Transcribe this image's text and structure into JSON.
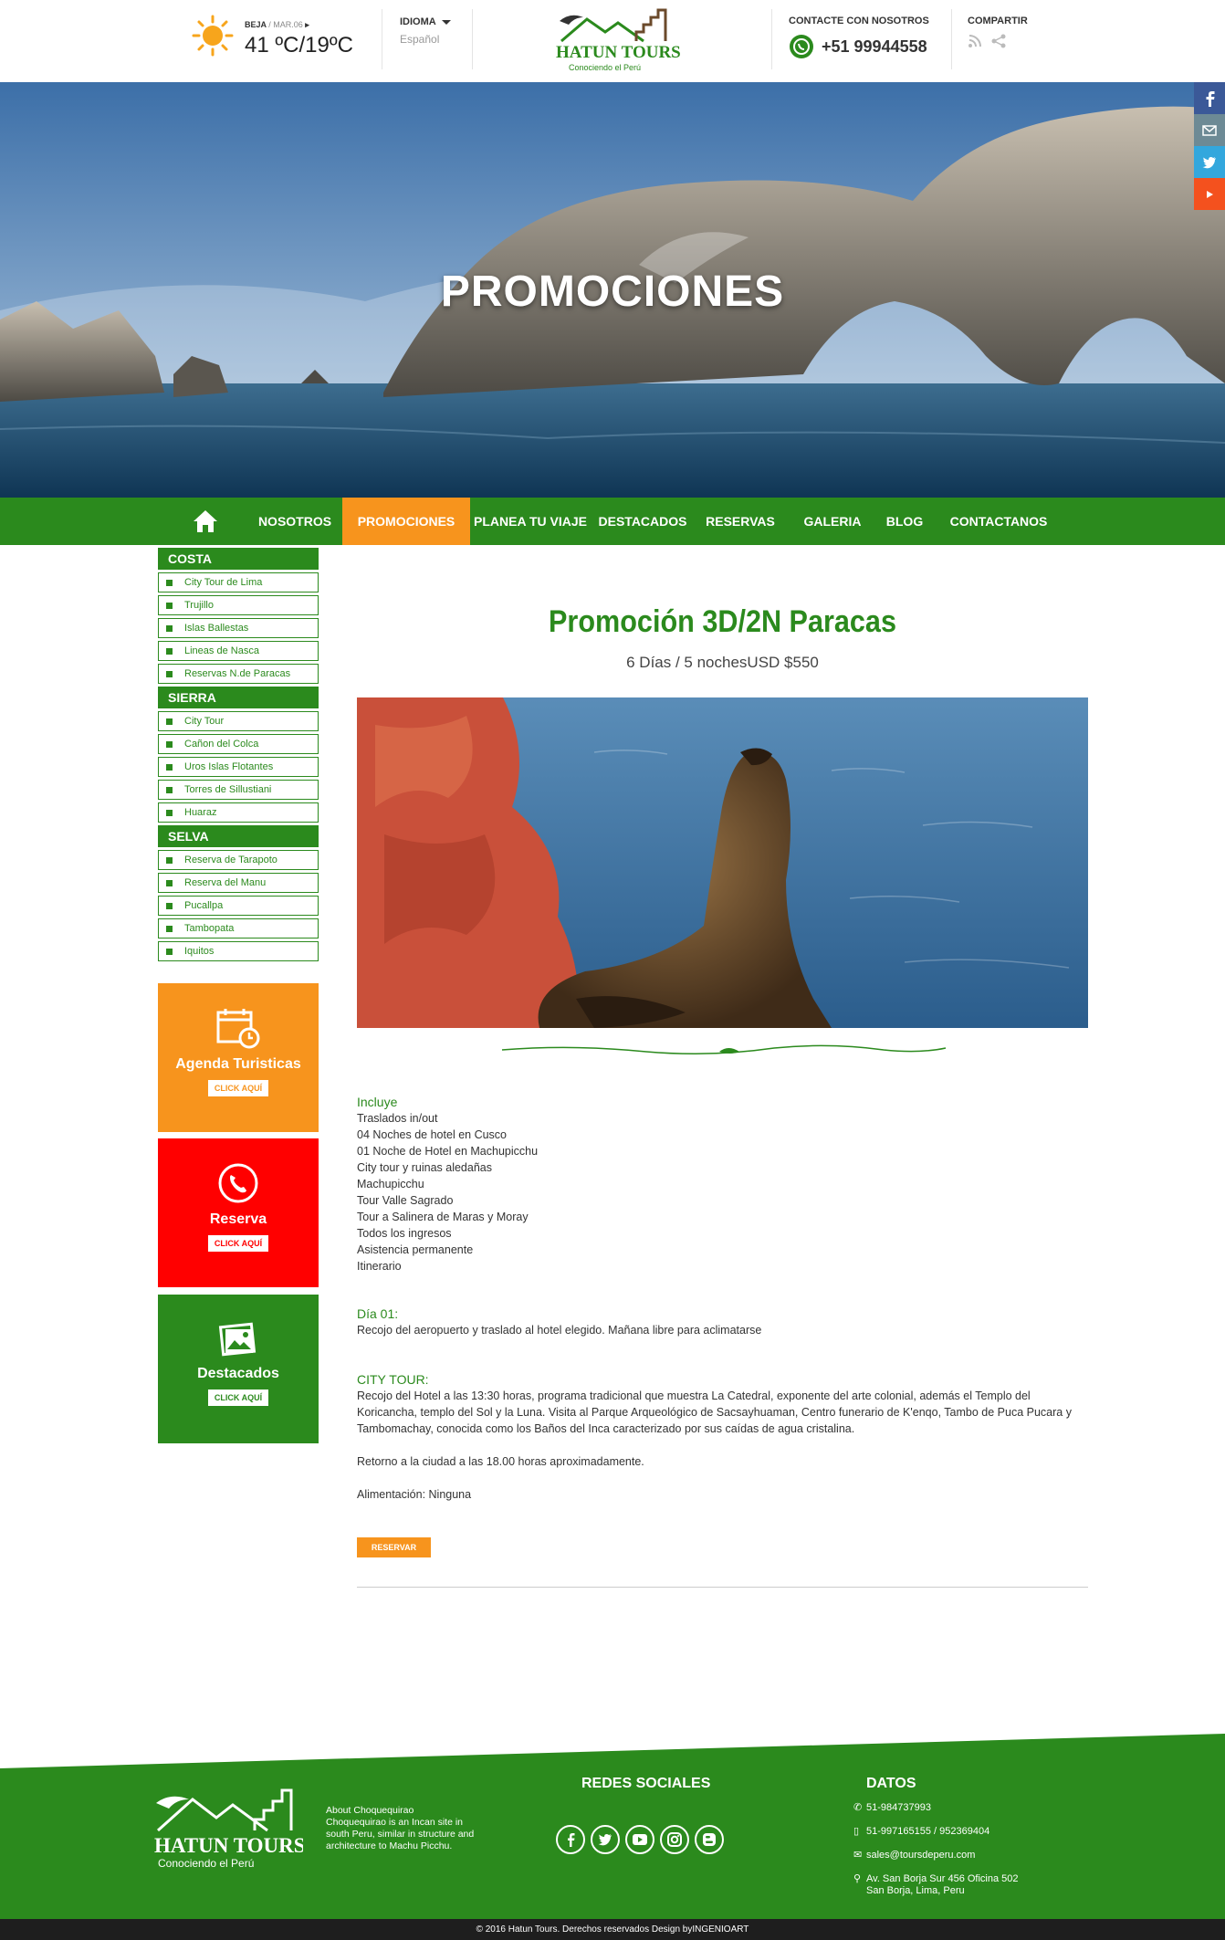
{
  "header": {
    "weather": {
      "location": "BEJA",
      "date": "/ MAR.06",
      "temp": "41 ºC/19ºC"
    },
    "language": {
      "title": "IDIOMA",
      "value": "Español"
    },
    "logo": {
      "name": "HATUN TOURS",
      "tagline": "Conociendo el Perú"
    },
    "contact": {
      "title": "CONTACTE CON NOSOTROS",
      "phone": "+51 99944558"
    },
    "share": {
      "title": "COMPARTIR"
    }
  },
  "hero": {
    "title": "PROMOCIONES"
  },
  "social_bar": [
    "facebook-icon",
    "email-icon",
    "twitter-icon",
    "youtube-icon"
  ],
  "nav": {
    "items": [
      {
        "label": "NOSOTROS"
      },
      {
        "label": "PROMOCIONES"
      },
      {
        "label": "PLANEA TU VIAJE"
      },
      {
        "label": "DESTACADOS"
      },
      {
        "label": "RESERVAS"
      },
      {
        "label": "GALERIA"
      },
      {
        "label": "BLOG"
      },
      {
        "label": "CONTACTANOS"
      }
    ],
    "active": "PROMOCIONES"
  },
  "sidebar": {
    "categories": [
      {
        "name": "COSTA",
        "links": [
          "City Tour de Lima",
          "Trujillo",
          "Islas Ballestas",
          "Lineas de Nasca",
          "Reservas N.de Paracas"
        ]
      },
      {
        "name": "SIERRA",
        "links": [
          "City Tour",
          "Cañon del Colca",
          "Uros Islas Flotantes",
          "Torres de Sillustiani",
          "Huaraz"
        ]
      },
      {
        "name": "SELVA",
        "links": [
          "Reserva de Tarapoto",
          "Reserva del Manu",
          "Pucallpa",
          "Tambopata",
          "Iquitos"
        ]
      }
    ],
    "promos": [
      {
        "title": "Agenda Turisticas",
        "button": "CLICK AQUÍ",
        "color": "#f7941d"
      },
      {
        "title": "Reserva",
        "button": "CLICK AQUÍ",
        "color": "#ff0000"
      },
      {
        "title": "Destacados",
        "button": "CLICK AQUÍ",
        "color": "#2b8a1d"
      }
    ]
  },
  "main": {
    "title": "Promoción 3D/2N Paracas",
    "subtitle": "6 Días / 5 nochesUSD $550",
    "includes_heading": "Incluye",
    "includes": [
      "Traslados in/out",
      "04 Noches de hotel en Cusco",
      "01 Noche de Hotel en Machupicchu",
      "City tour y ruinas aledañas",
      "Machupicchu",
      "Tour Valle Sagrado",
      "Tour a Salinera de Maras y Moray",
      "Todos los ingresos",
      "Asistencia permanente",
      "Itinerario"
    ],
    "day1_heading": "Día 01:",
    "day1_text": "Recojo del aeropuerto  y traslado al hotel elegido. Mañana libre para aclimatarse",
    "citytour_heading": "CITY TOUR:",
    "citytour_text": "Recojo del Hotel a las 13:30 horas, programa tradicional que muestra La Catedral, exponente del arte colonial, además el Templo del Koricancha, templo del Sol y la Luna. Visita al Parque Arqueológico de Sacsayhuaman, Centro funerario de K'enqo, Tambo de Puca Pucara y Tambomachay, conocida como los Baños del Inca  caracterizado por sus caídas de agua cristalina.",
    "return_text": "Retorno a la ciudad a las 18.00 horas aproximadamente.",
    "food_text": "Alimentación: Ninguna",
    "button": "RESERVAR"
  },
  "footer": {
    "about_title": "About Choquequirao",
    "about_text": "Choquequirao is an Incan site in south Peru, similar in structure and architecture to Machu Picchu.",
    "social_heading": "REDES SOCIALES",
    "social_icons": [
      "facebook-icon",
      "twitter-icon",
      "youtube-icon",
      "instagram-icon",
      "blogger-icon"
    ],
    "datos_heading": "DATOS",
    "phone1": "51-984737993",
    "phone2": "51-997165155 / 952369404",
    "email": "sales@toursdeperu.com",
    "address1": "Av. San Borja Sur 456 Oficina 502",
    "address2": "San Borja, Lima, Peru",
    "copyright": "© 2016  Hatun Tours. Derechos reservados Design byINGENIOART"
  },
  "colors": {
    "green": "#2b8a1d",
    "orange": "#f7941d",
    "red": "#ff0000"
  }
}
